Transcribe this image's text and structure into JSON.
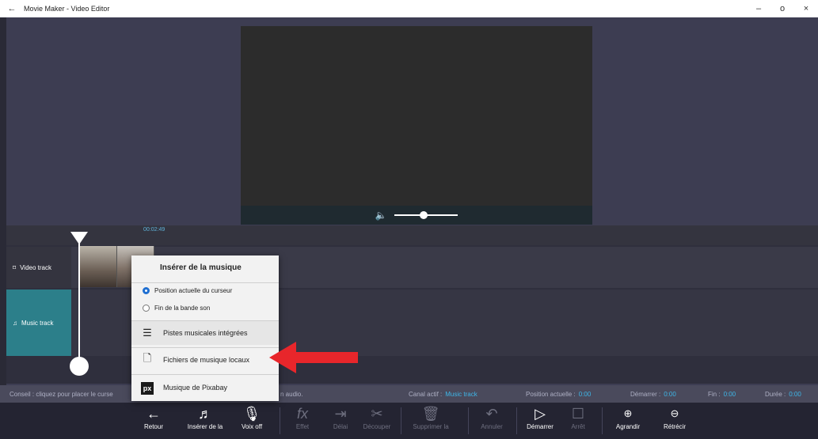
{
  "window": {
    "title": "Movie Maker - Video Editor",
    "back_icon": "arrow-left-icon",
    "minimize": "–",
    "maximize": "o",
    "close": "×"
  },
  "timeline": {
    "time_label": "00:02:49",
    "tracks": [
      {
        "label": "Video track",
        "icon": "film-icon"
      },
      {
        "label": "Music track",
        "icon": "music-note-icon"
      }
    ]
  },
  "popup": {
    "title": "Insérer de la musique",
    "radio_options": [
      {
        "label": "Position actuelle du curseur",
        "selected": true
      },
      {
        "label": "Fin de la bande son",
        "selected": false
      }
    ],
    "menu_items": [
      {
        "label": "Pistes musicales intégrées",
        "icon": "playlist-icon"
      },
      {
        "label": "Fichiers de musique locaux",
        "icon": "file-icon"
      },
      {
        "label": "Musique de Pixabay",
        "icon": "pixabay-icon",
        "logo_text": "px"
      }
    ]
  },
  "status": {
    "tip_start": "Conseil : cliquez pour placer le curse",
    "tip_end": "n audio.",
    "active_channel_label": "Canal actif :",
    "active_channel_value": "Music track",
    "current_position_label": "Position actuelle :",
    "current_position_value": "0:00",
    "start_label": "Démarrer :",
    "start_value": "0:00",
    "end_label": "Fin :",
    "end_value": "0:00",
    "duration_label": "Durée :",
    "duration_value": "0:00"
  },
  "toolbar": {
    "items": [
      {
        "label": "Retour",
        "icon": "arrow-left-icon",
        "enabled": true
      },
      {
        "label": "Insérer de la",
        "icon": "music-add-icon",
        "enabled": true
      },
      {
        "label": "Voix off",
        "icon": "microphone-icon",
        "enabled": true
      },
      {
        "label": "Effet",
        "icon": "fx-icon",
        "enabled": false
      },
      {
        "label": "Délai",
        "icon": "delay-icon",
        "enabled": false
      },
      {
        "label": "Découper",
        "icon": "scissors-icon",
        "enabled": false
      },
      {
        "label": "Supprimer la",
        "icon": "trash-icon",
        "enabled": false
      },
      {
        "label": "Annuler",
        "icon": "undo-icon",
        "enabled": false
      },
      {
        "label": "Démarrer",
        "icon": "play-icon",
        "enabled": true
      },
      {
        "label": "Arrêt",
        "icon": "stop-icon",
        "enabled": false
      },
      {
        "label": "Agrandir",
        "icon": "zoom-in-icon",
        "enabled": true
      },
      {
        "label": "Rétrécir",
        "icon": "zoom-out-icon",
        "enabled": true
      }
    ]
  },
  "colors": {
    "accent": "#3eb6e8",
    "music_track": "#2c7f8a",
    "highlight_arrow": "#e8262b",
    "radio": "#1f6fd1"
  }
}
